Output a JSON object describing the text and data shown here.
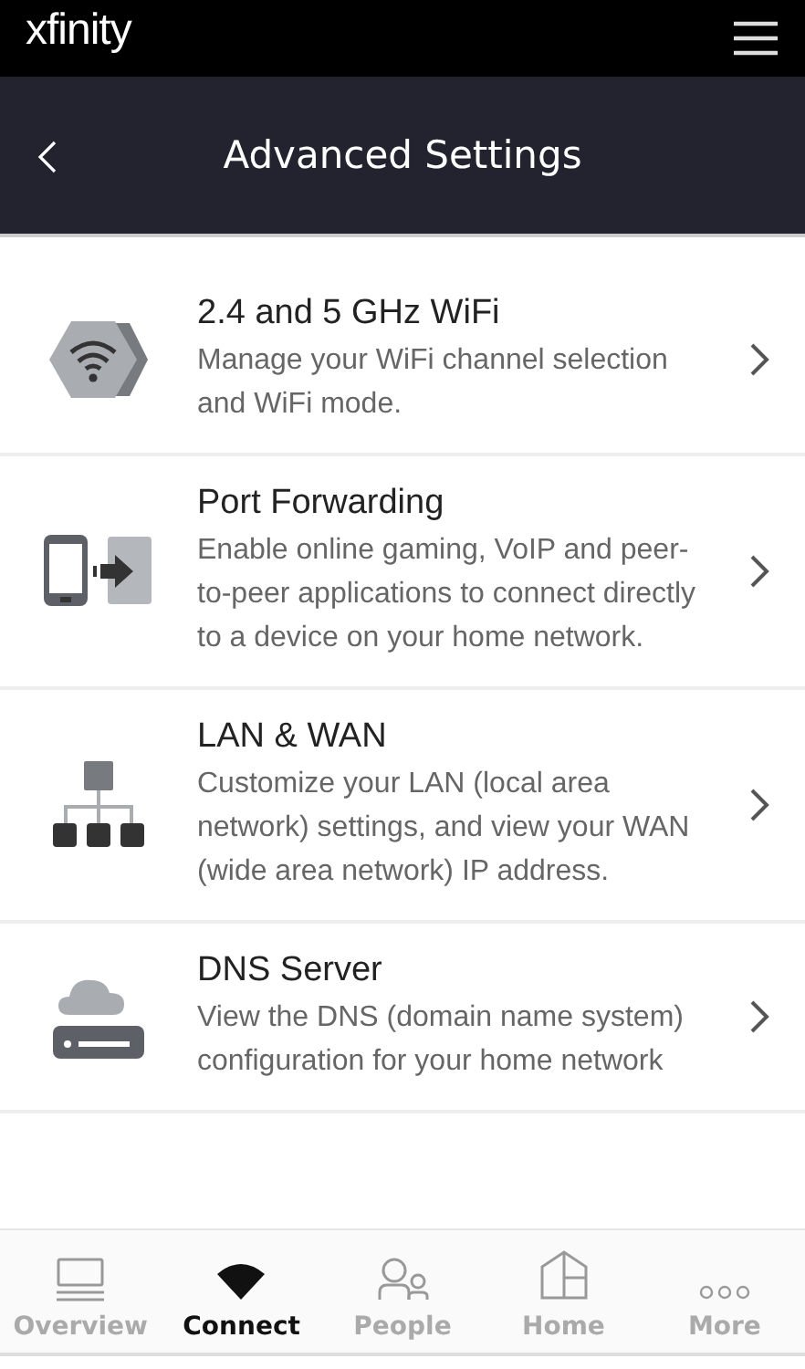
{
  "top_bar": {
    "logo": "xfinity"
  },
  "header": {
    "title": "Advanced Settings"
  },
  "settings": [
    {
      "title": "2.4 and 5 GHz WiFi",
      "description": "Manage your WiFi channel selection and WiFi mode."
    },
    {
      "title": "Port Forwarding",
      "description": "Enable online gaming, VoIP and peer-to-peer applications to connect directly to a device on your home network."
    },
    {
      "title": "LAN & WAN",
      "description": "Customize your LAN (local area network) settings, and view your WAN (wide area network) IP address."
    },
    {
      "title": "DNS Server",
      "description": "View the DNS (domain name system) configuration for your home network"
    }
  ],
  "tab_bar": [
    {
      "label": "Overview",
      "selected": false
    },
    {
      "label": "Connect",
      "selected": true
    },
    {
      "label": "People",
      "selected": false
    },
    {
      "label": "Home",
      "selected": false
    },
    {
      "label": "More",
      "selected": false
    }
  ]
}
